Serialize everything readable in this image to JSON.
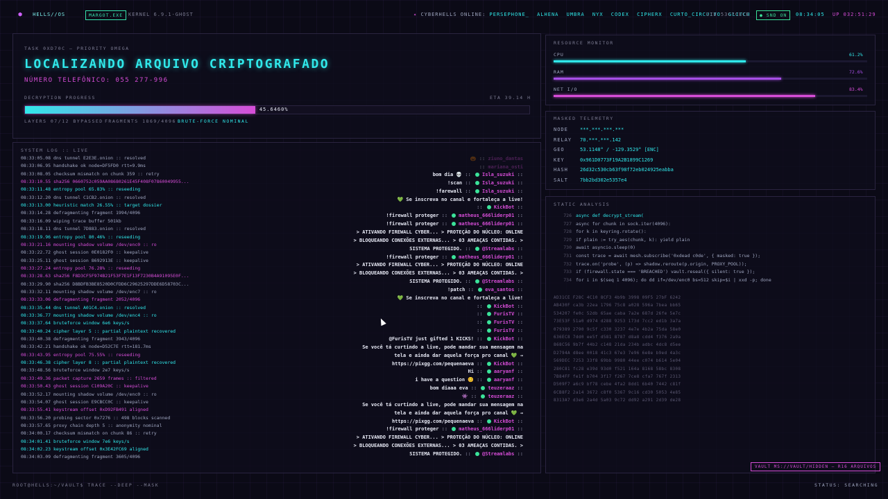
{
  "topbar": {
    "logo": "⬢",
    "brand": "HELLS//OS",
    "proc_pill": "MARGOT.EXE",
    "kernel": "KERNEL 6.9.1-GHOST",
    "online_label": "CYBERHELLS ONLINE:",
    "online_users": [
      "PERSEPHONE_",
      "ALHENA",
      "UMBRA",
      "NYX",
      "CODEX",
      "CIPHERX",
      "CURTO_CIRCUITO",
      "GLITCH"
    ],
    "sid": "SID 53C7CECE",
    "snd_pill": "SND ON",
    "clock": "08:34:05",
    "uptime": "UP 032:51:29"
  },
  "task": {
    "label": "TASK 0XD70C — PRIORITY OMEGA",
    "title": "LOCALIZANDO ARQUIVO CRIPTOGRAFADO",
    "phone": "NÚMERO TELEFÔNICO: 055 277-996",
    "progress_label": "DECRYPTION PROGRESS",
    "eta": "ETA 39.14 H",
    "progress_value": 0.45646,
    "progress_text": "45.6460%",
    "layers": "LAYERS 07/12 BYPASSED",
    "fragments": "FRAGMENTS 1869/4096",
    "bruteforce": "BRUTE-FORCE NOMINAL"
  },
  "resources": {
    "label": "RESOURCE MONITOR",
    "items": [
      {
        "name": "CPU",
        "value": "61.2%",
        "fraction": 0.612,
        "color": "#30e8ea"
      },
      {
        "name": "RAM",
        "value": "72.6%",
        "fraction": 0.726,
        "color": "#a64ee6"
      },
      {
        "name": "NET I/O",
        "value": "83.4%",
        "fraction": 0.834,
        "color": "#d74dd8"
      }
    ]
  },
  "telemetry": {
    "label": "MASKED TELEMETRY",
    "rows": [
      {
        "k": "NODE",
        "v": "***.***.***.***"
      },
      {
        "k": "RELAY",
        "v": "70.***.***.142"
      },
      {
        "k": "GEO",
        "v": "53.1148° / -129.3529° [ENC]"
      },
      {
        "k": "KEY",
        "v": "0x961D0773F19A2B1899C1269"
      },
      {
        "k": "HASH",
        "v": "26d32c530cb63f98f72eb024925eabba"
      },
      {
        "k": "SALT",
        "v": "7bb2bd302e5357e4"
      }
    ]
  },
  "static": {
    "label": "STATIC ANALYSIS",
    "code": [
      {
        "n": "726",
        "t": "async def decrypt_stream(",
        "c": "#30e8ea"
      },
      {
        "n": "727",
        "t": "async for chunk in sock.iter(4096):",
        "c": "#9ea5bf"
      },
      {
        "n": "728",
        "t": "for k in keyring.rotate():",
        "c": "#9ea5bf"
      },
      {
        "n": "729",
        "t": "if plain := try_aes(chunk, k): yield plain",
        "c": "#9ea5bf"
      },
      {
        "n": "730",
        "t": "await asyncio.sleep(0)",
        "c": "#9ea5bf"
      },
      {
        "n": "731",
        "t": "const trace = await mesh.subscribe('0xdead c0de', { masked: true });",
        "c": "#9ea5bf"
      },
      {
        "n": "732",
        "t": "trace.on('probe', (p) => shadow.reroute(p.origin, PROXY_POOL));",
        "c": "#9ea5bf"
      },
      {
        "n": "733",
        "t": "if (firewall.state === 'BREACHED') vault.reseal({ silent: true });",
        "c": "#9ea5bf"
      },
      {
        "n": "734",
        "t": "for i in $(seq 1 4096); do dd if=/dev/enc0 bs=512 skip=$i | xxd -p; done",
        "c": "#9ea5bf"
      }
    ],
    "hex": [
      "AD31CE F28C 4C10 8CF3 4b9b 3998 09F5 27bF 6242",
      "AB430F ca3b 22ea 1796 75c8 a028 596a 7bea bb65",
      "534207 fe0c 52db 65ae caba 7a2e 687d 26fe 5e7c",
      "73E53F 51a0 d974 d288 9253 173d 7cc2 ed1b 3a7a",
      "079389 2790 9c5f c330 3237 4e7e 4b2a 75da 58e0",
      "636EC8 7dd0 ee5f d581 8787 d8a8 cdd4 f376 2a9a",
      "868C56 9b7f 44b2 c148 21da 234b adbc 4dc8 d5ee",
      "D2794A d8ee 0018 41c3 67e3 7e96 6e8e b9ed 4a3c",
      "569DEC 7253 33f8 69bb 9980 44ee c074 b614 5e04",
      "280C81 fc28 e39d 93d0 f521 164a 8168 58bc 8308",
      "7B84FF fe1f b704 3f17 f267 7ce8 cfa7 767f 2313",
      "D509F7 a6c9 bf78 cebe 4fa2 8dd1 6b40 7442 c81f",
      "6CB8F2 2a14 3672 c8f0 5367 9c16 cd30 5053 4e85",
      "8313A7 d3e6 2a4d 5a03 9c72 dd92 a291 2d39 de28"
    ]
  },
  "syslog": {
    "label": "SYSTEM LOG :: LIVE",
    "lines": [
      {
        "t": "08:33:05.08 dns tunnel E2E3E.onion :: resolved",
        "c": "#9ea5bf"
      },
      {
        "t": "08:33:06.95 handshake ok node=DF5FD0 rtt=9.9ms",
        "c": "#9ea5bf"
      },
      {
        "t": "08:33:08.05 checksum mismatch on chunk 359 :: retry",
        "c": "#9ea5bf"
      },
      {
        "t": "08:33:10.55 sha256 0660752c059AA08680261E45F408F07860049955...",
        "c": "#d74dd8"
      },
      {
        "t": "08:33:11.48 entropy pool 65.83% :: reseeding",
        "c": "#30e8ea"
      },
      {
        "t": "08:33:12.20 dns tunnel C1CB2.onion :: resolved",
        "c": "#9ea5bf"
      },
      {
        "t": "08:33:13.00 heuristic match 26.55% :: target dossier",
        "c": "#30e8ea"
      },
      {
        "t": "08:33:14.28 defragmenting fragment 1994/4096",
        "c": "#9ea5bf"
      },
      {
        "t": "08:33:16.09 wiping trace buffer 501kb",
        "c": "#9ea5bf"
      },
      {
        "t": "08:33:18.11 dns tunnel 7D883.onion :: resolved",
        "c": "#9ea5bf"
      },
      {
        "t": "08:33:19.96 entropy pool 80.46% :: reseeding",
        "c": "#30e8ea"
      },
      {
        "t": "08:33:21.16 mounting shadow volume /dev/enc0 :: ro",
        "c": "#d74dd8"
      },
      {
        "t": "08:33:22.72 ghost session 0E0182F0 :: keepalive",
        "c": "#9ea5bf"
      },
      {
        "t": "08:33:25.11 ghost session 8692913E :: keepalive",
        "c": "#9ea5bf"
      },
      {
        "t": "08:33:27.24 entropy pool 76.28% :: reseeding",
        "c": "#d74dd8"
      },
      {
        "t": "08:33:28.63 sha256 F8D3CF5F974B21F53F7E1F13F7230B4A91095E0F...",
        "c": "#d74dd8"
      },
      {
        "t": "08:33:29.90 sha256 D8BDFB3BE8520D0CFDD6C29625297DDE6D58703C...",
        "c": "#9ea5bf"
      },
      {
        "t": "08:33:32.11 mounting shadow volume /dev/enc7 :: ro",
        "c": "#9ea5bf"
      },
      {
        "t": "08:33:33.06 defragmenting fragment 2052/4096",
        "c": "#d74dd8"
      },
      {
        "t": "08:33:35.44 dns tunnel A01C4.onion :: resolved",
        "c": "#30e8ea"
      },
      {
        "t": "08:33:36.77 mounting shadow volume /dev/enc4 :: ro",
        "c": "#30e8ea"
      },
      {
        "t": "08:33:37.64 bruteforce window 6e6 keys/s",
        "c": "#30e8ea"
      },
      {
        "t": "08:33:40.24 cipher layer 5 :: partial plaintext recovered",
        "c": "#30e8ea"
      },
      {
        "t": "08:33:40.38 defragmenting fragment 3943/4096",
        "c": "#9ea5bf"
      },
      {
        "t": "08:33:42.21 handshake ok node=D52C7E rtt=181.7ms",
        "c": "#9ea5bf"
      },
      {
        "t": "08:33:43.95 entropy pool 75.55% :: reseeding",
        "c": "#d74dd8"
      },
      {
        "t": "08:33:46.38 cipher layer 8 :: partial plaintext recovered",
        "c": "#30e8ea"
      },
      {
        "t": "08:33:48.56 bruteforce window 2e7 keys/s",
        "c": "#9ea5bf"
      },
      {
        "t": "08:33:49.36 packet capture 2659 frames :: filtered",
        "c": "#d74dd8"
      },
      {
        "t": "08:33:50.43 ghost session C109A20C :: keepalive",
        "c": "#d74dd8"
      },
      {
        "t": "08:33:52.17 mounting shadow volume /dev/enc0 :: ro",
        "c": "#9ea5bf"
      },
      {
        "t": "08:33:54.07 ghost session E9CBCC0C :: keepalive",
        "c": "#9ea5bf"
      },
      {
        "t": "08:33:55.41 keystream offset 0xD92FB491 aligned",
        "c": "#d74dd8"
      },
      {
        "t": "08:33:56.20 probing sector 0x7276 :: 498 blocks scanned",
        "c": "#9ea5bf"
      },
      {
        "t": "08:33:57.65 proxy chain depth 5 :: anonymity nominal",
        "c": "#9ea5bf"
      },
      {
        "t": "08:34:00.17 checksum mismatch on chunk 86 :: retry",
        "c": "#9ea5bf"
      },
      {
        "t": "08:34:01.41 bruteforce window 7e6 keys/s",
        "c": "#30e8ea"
      },
      {
        "t": "08:34:02.23 keystream offset 0x3E42FC69 aligned",
        "c": "#30e8ea"
      },
      {
        "t": "08:34:03.09 defragmenting fragment 3605/4096",
        "c": "#9ea5bf"
      }
    ]
  },
  "chat": [
    {
      "msg": "bom dia 💀",
      "user": "Isla_suzuki"
    },
    {
      "msg": "!scan",
      "user": "Isla_suzuki"
    },
    {
      "msg": "!farewall",
      "user": "Isla_suzuki"
    },
    {
      "msg": "💚 Se inscreva no canal e fortaleça a live!",
      "user": ""
    },
    {
      "msg": "",
      "user": "KickBot"
    },
    {
      "msg": "!firewall proteger",
      "user": "matheus_666liderp01"
    },
    {
      "msg": "!firewall proteger",
      "user": "matheus_666liderp01"
    },
    {
      "msg": "> ATIVANDO FIREWALL CYBER... > PROTEÇÃO DO NÚCLEO: ONLINE",
      "user": ""
    },
    {
      "msg": "> BLOQUEANDO CONEXÕES EXTERNAS... > 03 AMEAÇAS CONTIDAS. >",
      "user": ""
    },
    {
      "msg": "SISTEMA PROTEGIDO.",
      "user": "@Streamlabs"
    },
    {
      "msg": "!firewall proteger",
      "user": "matheus_666liderp01"
    },
    {
      "msg": "> ATIVANDO FIREWALL CYBER... > PROTEÇÃO DO NÚCLEO: ONLINE",
      "user": ""
    },
    {
      "msg": "> BLOQUEANDO CONEXÕES EXTERNAS... > 03 AMEAÇAS CONTIDAS. >",
      "user": ""
    },
    {
      "msg": "SISTEMA PROTEGIDO.",
      "user": "@Streamlabs"
    },
    {
      "msg": "!patch",
      "user": "eva_santos"
    },
    {
      "msg": "💚 Se inscreva no canal e fortaleça a live!",
      "user": ""
    },
    {
      "msg": "",
      "user": "KickBot"
    },
    {
      "msg": "",
      "user": "FurisTV"
    },
    {
      "msg": "",
      "user": "FurisTV"
    },
    {
      "msg": "",
      "user": "FurisTV"
    },
    {
      "msg": "@FurisTV just gifted 1 KICKS!",
      "user": "KickBot"
    },
    {
      "msg": "Se você tá curtindo a live, pode mandar sua mensagem na",
      "user": ""
    },
    {
      "msg": "tela e ainda dar aquela força pro canal 💚 →",
      "user": ""
    },
    {
      "msg": "https://pixgg.com/pequenaeva",
      "user": "KickBot"
    },
    {
      "msg": "Hi",
      "user": "aaryanf"
    },
    {
      "msg": "i have a question 😊",
      "user": "aaryanf"
    },
    {
      "msg": "bom diaaa eva",
      "user": "teuzeraaz"
    },
    {
      "msg": "👾",
      "user": "teuzeraaz"
    },
    {
      "msg": "Se você tá curtindo a live, pode mandar sua mensagem na",
      "user": ""
    },
    {
      "msg": "tela e ainda dar aquela força pro canal 💚 →",
      "user": ""
    },
    {
      "msg": "https://pixgg.com/pequenaeva",
      "user": "KickBot"
    },
    {
      "msg": "!firewall proteger",
      "user": "matheus_666liderp01"
    },
    {
      "msg": "> ATIVANDO FIREWALL CYBER... > PROTEÇÃO DO NÚCLEO: ONLINE",
      "user": ""
    },
    {
      "msg": "> BLOQUEANDO CONEXÕES EXTERNAS... > 03 AMEAÇAS CONTIDAS. >",
      "user": ""
    },
    {
      "msg": "SISTEMA PROTEGIDO.",
      "user": "@Streamlabs"
    }
  ],
  "chat_faded": [
    {
      "msg": "🎃 ::",
      "user": "ziuno_dantas"
    },
    {
      "msg": "::",
      "user": "mariana_osti"
    }
  ],
  "footer": {
    "prompt": "ROOT@HELLS:~/VAULT$ TRACE --DEEP --MASK",
    "status": "STATUS: SEARCHING",
    "vault": "VAULT MS://VAULT/HIDDEN — R16 ARQUIVOS"
  },
  "colors": {
    "accent_cyan": "#30e8ea",
    "accent_magenta": "#d74dd8",
    "accent_green": "#3be39a"
  }
}
